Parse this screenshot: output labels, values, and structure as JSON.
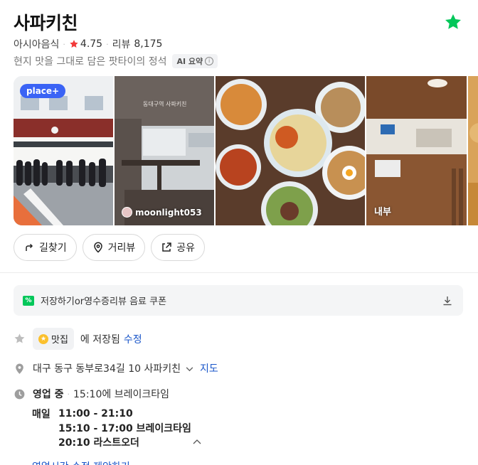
{
  "place": {
    "name": "사파키친",
    "category": "아시아음식",
    "rating": "4.75",
    "review_label": "리뷰",
    "review_count": "8,175",
    "description": "현지 맛을 그대로 담은 팟타이의 정석",
    "ai_badge": "AI 요약",
    "ai_info": "i"
  },
  "photos": {
    "place_badge": "place+",
    "user": "moonlight053",
    "interior_caption": "내부",
    "sign_text": "동대구역 사파키친"
  },
  "actions": {
    "directions": "길찾기",
    "roadview": "거리뷰",
    "share": "공유"
  },
  "coupon": {
    "icon_text": "%",
    "text": "저장하기or영수증리뷰 음료 쿠폰"
  },
  "saved": {
    "chip_label": "맛집",
    "text": "에 저장됨",
    "edit": "수정"
  },
  "address": {
    "text": "대구 동구 동부로34길 10 사파키친",
    "map_link": "지도"
  },
  "hours": {
    "status": "영업 중",
    "next": "15:10에 브레이크타임",
    "day": "매일",
    "lines": [
      "11:00 - 21:10",
      "15:10 - 17:00 브레이크타임",
      "20:10 라스트오더"
    ]
  },
  "footer_partial": "영업시간 수정 제안하기",
  "colors": {
    "accent_green": "#03c75a",
    "star_red": "#f23a3a",
    "link_blue": "#1a56c9",
    "badge_blue": "#3a63f5"
  }
}
